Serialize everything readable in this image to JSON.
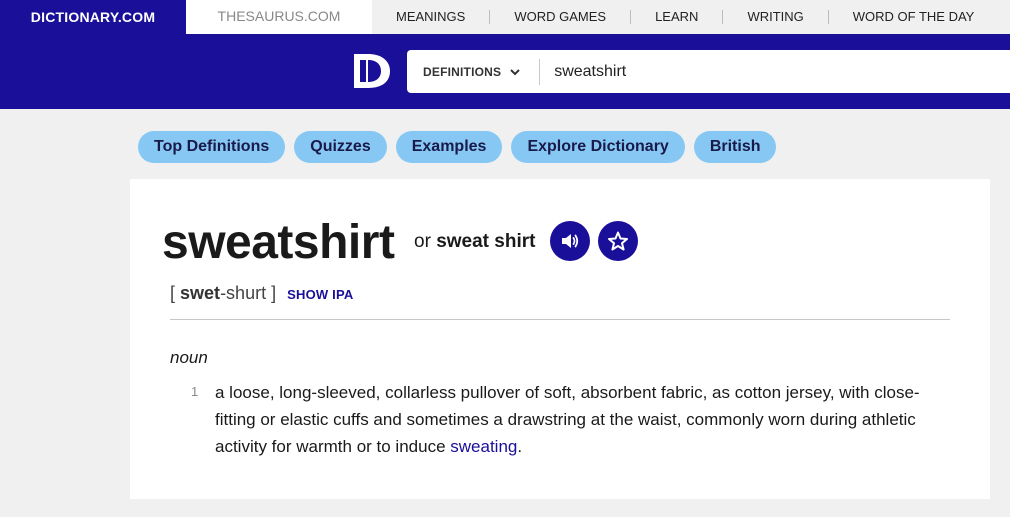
{
  "topnav": {
    "site_tab": "DICTIONARY.COM",
    "thesaurus_tab": "THESAURUS.COM",
    "links": [
      "MEANINGS",
      "WORD GAMES",
      "LEARN",
      "WRITING",
      "WORD OF THE DAY"
    ]
  },
  "search": {
    "type_label": "DEFINITIONS",
    "value": "sweatshirt"
  },
  "pills": [
    "Top Definitions",
    "Quizzes",
    "Examples",
    "Explore Dictionary",
    "British"
  ],
  "entry": {
    "headword": "sweatshirt",
    "variant_or": "or",
    "variant": "sweat shirt",
    "pron_open": "[",
    "pron_stress": "swet",
    "pron_rest": "-shurt",
    "pron_close": "]",
    "show_ipa": "SHOW IPA",
    "pos": "noun",
    "definitions": [
      {
        "number": "1",
        "text": "a loose, long-sleeved, collarless pullover of soft, absorbent fabric, as cotton jersey, with close-fitting or elastic cuffs and sometimes a drawstring at the waist, commonly worn during athletic activity for warmth or to induce",
        "link": "sweating",
        "end": "."
      }
    ]
  },
  "colors": {
    "brand": "#1a0f99",
    "pill": "#86c8f3"
  },
  "icons": {
    "logo": "dictionary-logo",
    "dropdown": "chevron-down-icon",
    "audio": "speaker-icon",
    "favorite": "star-icon"
  }
}
